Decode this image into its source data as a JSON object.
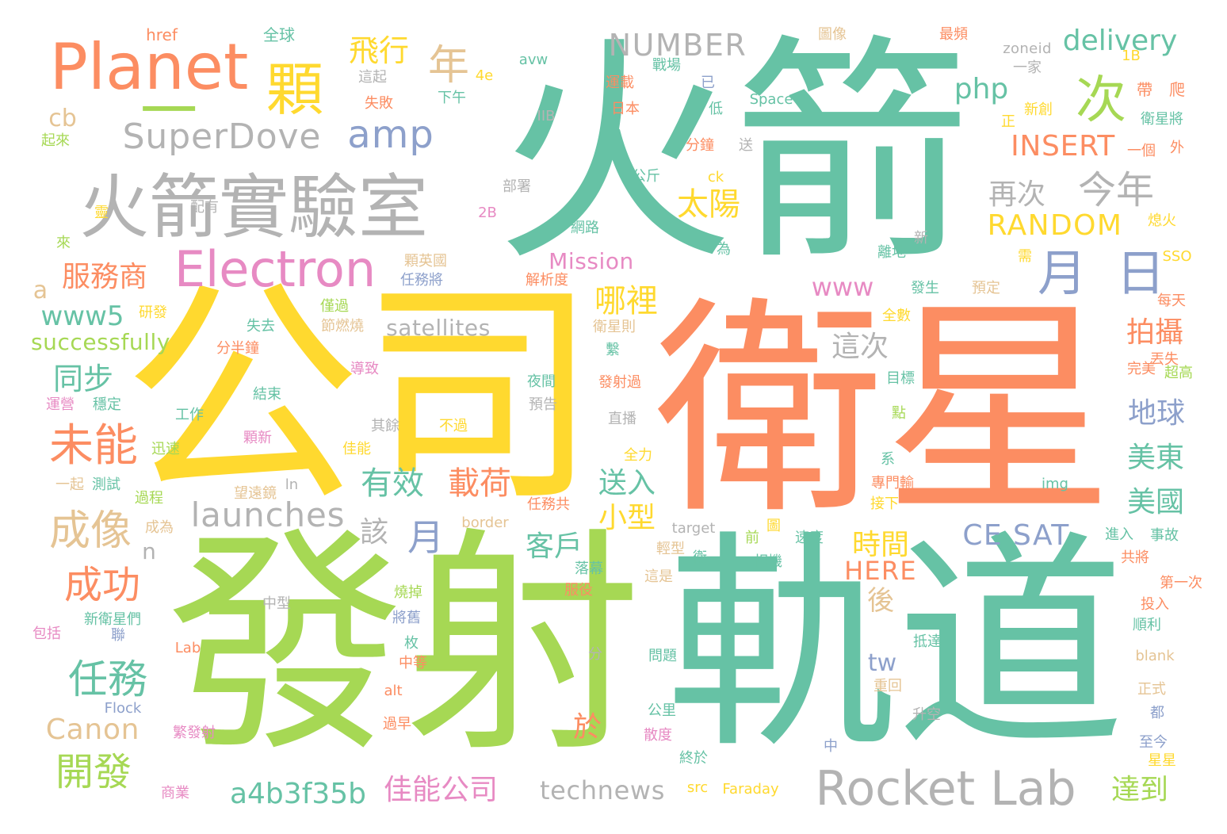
{
  "palette": {
    "teal": "#66c2a5",
    "orange": "#fc8d62",
    "blue": "#8da0cb",
    "pink": "#e78ac3",
    "green": "#a6d854",
    "yellow": "#ffd92f",
    "tan": "#e5c494",
    "gray": "#b3b3b3"
  },
  "words": [
    {
      "text": "火箭",
      "color": "teal"
    },
    {
      "text": "衛星",
      "color": "orange"
    },
    {
      "text": "公司",
      "color": "yellow"
    },
    {
      "text": "發射",
      "color": "green"
    },
    {
      "text": "軌道",
      "color": "teal"
    },
    {
      "text": "火箭實驗室",
      "color": "gray"
    },
    {
      "text": "Planet",
      "color": "orange"
    },
    {
      "text": "一",
      "color": "green"
    },
    {
      "text": "顆",
      "color": "yellow"
    },
    {
      "text": "Electron",
      "color": "pink"
    },
    {
      "text": "次",
      "color": "green"
    },
    {
      "text": "月",
      "color": "blue"
    },
    {
      "text": "日",
      "color": "blue"
    },
    {
      "text": "Rocket Lab",
      "color": "gray"
    },
    {
      "text": "SuperDove",
      "color": "gray"
    },
    {
      "text": "amp",
      "color": "blue"
    },
    {
      "text": "年",
      "color": "tan"
    },
    {
      "text": "飛行",
      "color": "yellow"
    },
    {
      "text": "NUMBER",
      "color": "gray"
    },
    {
      "text": "delivery",
      "color": "teal"
    },
    {
      "text": "php",
      "color": "teal"
    },
    {
      "text": "今年",
      "color": "gray"
    },
    {
      "text": "再次",
      "color": "gray"
    },
    {
      "text": "INSERT",
      "color": "orange"
    },
    {
      "text": "RANDOM",
      "color": "yellow"
    },
    {
      "text": "太陽",
      "color": "yellow"
    },
    {
      "text": "www",
      "color": "pink"
    },
    {
      "text": "Mission",
      "color": "pink"
    },
    {
      "text": "服務商",
      "color": "orange"
    },
    {
      "text": "cb",
      "color": "tan"
    },
    {
      "text": "a",
      "color": "tan"
    },
    {
      "text": "www5",
      "color": "teal"
    },
    {
      "text": "successfully",
      "color": "green"
    },
    {
      "text": "satellites",
      "color": "gray"
    },
    {
      "text": "哪裡",
      "color": "yellow"
    },
    {
      "text": "拍攝",
      "color": "orange"
    },
    {
      "text": "這次",
      "color": "gray"
    },
    {
      "text": "地球",
      "color": "blue"
    },
    {
      "text": "美東",
      "color": "teal"
    },
    {
      "text": "美國",
      "color": "teal"
    },
    {
      "text": "同步",
      "color": "teal"
    },
    {
      "text": "未能",
      "color": "orange"
    },
    {
      "text": "有效",
      "color": "teal"
    },
    {
      "text": "載荷",
      "color": "orange"
    },
    {
      "text": "送入",
      "color": "teal"
    },
    {
      "text": "小型",
      "color": "yellow"
    },
    {
      "text": "launches",
      "color": "gray"
    },
    {
      "text": "成像",
      "color": "tan"
    },
    {
      "text": "該",
      "color": "gray"
    },
    {
      "text": "月",
      "color": "blue"
    },
    {
      "text": "客戶",
      "color": "teal"
    },
    {
      "text": "CE SAT",
      "color": "blue"
    },
    {
      "text": "時間",
      "color": "yellow"
    },
    {
      "text": "HERE",
      "color": "orange"
    },
    {
      "text": "成功",
      "color": "orange"
    },
    {
      "text": "n",
      "color": "gray"
    },
    {
      "text": "後",
      "color": "tan"
    },
    {
      "text": "任務",
      "color": "teal"
    },
    {
      "text": "tw",
      "color": "blue"
    },
    {
      "text": "於",
      "color": "orange"
    },
    {
      "text": "Canon",
      "color": "tan"
    },
    {
      "text": "開發",
      "color": "green"
    },
    {
      "text": "a4b3f35b",
      "color": "teal"
    },
    {
      "text": "佳能公司",
      "color": "pink"
    },
    {
      "text": "technews",
      "color": "gray"
    },
    {
      "text": "達到",
      "color": "green"
    },
    {
      "text": "href",
      "color": "orange"
    },
    {
      "text": "全球",
      "color": "teal"
    },
    {
      "text": "4e",
      "color": "yellow"
    },
    {
      "text": "avw",
      "color": "teal"
    },
    {
      "text": "這起",
      "color": "gray"
    },
    {
      "text": "失敗",
      "color": "orange"
    },
    {
      "text": "下午",
      "color": "teal"
    },
    {
      "text": "起來",
      "color": "green"
    },
    {
      "text": "IIB",
      "color": "gray"
    },
    {
      "text": "戰場",
      "color": "teal"
    },
    {
      "text": "運載",
      "color": "orange"
    },
    {
      "text": "已",
      "color": "blue"
    },
    {
      "text": "低",
      "color": "teal"
    },
    {
      "text": "日本",
      "color": "orange"
    },
    {
      "text": "Space",
      "color": "teal"
    },
    {
      "text": "圖像",
      "color": "tan"
    },
    {
      "text": "最頻",
      "color": "orange"
    },
    {
      "text": "zoneid",
      "color": "gray"
    },
    {
      "text": "一家",
      "color": "gray"
    },
    {
      "text": "1B",
      "color": "yellow"
    },
    {
      "text": "帶",
      "color": "orange"
    },
    {
      "text": "爬",
      "color": "orange"
    },
    {
      "text": "新創",
      "color": "yellow"
    },
    {
      "text": "正",
      "color": "yellow"
    },
    {
      "text": "衛星將",
      "color": "teal"
    },
    {
      "text": "一個",
      "color": "orange"
    },
    {
      "text": "外",
      "color": "orange"
    },
    {
      "text": "分鐘",
      "color": "orange"
    },
    {
      "text": "送",
      "color": "gray"
    },
    {
      "text": "ck",
      "color": "yellow"
    },
    {
      "text": "公斤",
      "color": "teal"
    },
    {
      "text": "部署",
      "color": "gray"
    },
    {
      "text": "配有",
      "color": "gray"
    },
    {
      "text": "靈",
      "color": "yellow"
    },
    {
      "text": "來",
      "color": "green"
    },
    {
      "text": "2B",
      "color": "pink"
    },
    {
      "text": "網路",
      "color": "teal"
    },
    {
      "text": "為",
      "color": "teal"
    },
    {
      "text": "新",
      "color": "gray"
    },
    {
      "text": "熄火",
      "color": "yellow"
    },
    {
      "text": "需",
      "color": "yellow"
    },
    {
      "text": "SSO",
      "color": "yellow"
    },
    {
      "text": "顆英國",
      "color": "tan"
    },
    {
      "text": "任務將",
      "color": "blue"
    },
    {
      "text": "解析度",
      "color": "orange"
    },
    {
      "text": "離地",
      "color": "teal"
    },
    {
      "text": "發生",
      "color": "teal"
    },
    {
      "text": "預定",
      "color": "tan"
    },
    {
      "text": "每天",
      "color": "orange"
    },
    {
      "text": "研發",
      "color": "yellow"
    },
    {
      "text": "僅過",
      "color": "green"
    },
    {
      "text": "節燃燒",
      "color": "tan"
    },
    {
      "text": "失去",
      "color": "teal"
    },
    {
      "text": "衛星則",
      "color": "tan"
    },
    {
      "text": "全數",
      "color": "yellow"
    },
    {
      "text": "丟失",
      "color": "orange"
    },
    {
      "text": "超高",
      "color": "green"
    },
    {
      "text": "完美",
      "color": "orange"
    },
    {
      "text": "分半鐘",
      "color": "orange"
    },
    {
      "text": "繫",
      "color": "teal"
    },
    {
      "text": "導致",
      "color": "pink"
    },
    {
      "text": "結束",
      "color": "teal"
    },
    {
      "text": "夜間",
      "color": "teal"
    },
    {
      "text": "發射過",
      "color": "orange"
    },
    {
      "text": "目標",
      "color": "teal"
    },
    {
      "text": "運營",
      "color": "pink"
    },
    {
      "text": "穩定",
      "color": "teal"
    },
    {
      "text": "工作",
      "color": "teal"
    },
    {
      "text": "預告",
      "color": "gray"
    },
    {
      "text": "點",
      "color": "green"
    },
    {
      "text": "其餘",
      "color": "gray"
    },
    {
      "text": "不過",
      "color": "yellow"
    },
    {
      "text": "直播",
      "color": "gray"
    },
    {
      "text": "迅速",
      "color": "green"
    },
    {
      "text": "顆新",
      "color": "pink"
    },
    {
      "text": "佳能",
      "color": "yellow"
    },
    {
      "text": "全力",
      "color": "yellow"
    },
    {
      "text": "系",
      "color": "teal"
    },
    {
      "text": "一起",
      "color": "tan"
    },
    {
      "text": "測試",
      "color": "teal"
    },
    {
      "text": "ln",
      "color": "gray"
    },
    {
      "text": "專門輸",
      "color": "orange"
    },
    {
      "text": "img",
      "color": "teal"
    },
    {
      "text": "過程",
      "color": "green"
    },
    {
      "text": "望遠鏡",
      "color": "tan"
    },
    {
      "text": "任務共",
      "color": "orange"
    },
    {
      "text": "接下",
      "color": "yellow"
    },
    {
      "text": "成為",
      "color": "tan"
    },
    {
      "text": "border",
      "color": "tan"
    },
    {
      "text": "target",
      "color": "gray"
    },
    {
      "text": "圖",
      "color": "yellow"
    },
    {
      "text": "進入",
      "color": "teal"
    },
    {
      "text": "事故",
      "color": "teal"
    },
    {
      "text": "輕型",
      "color": "tan"
    },
    {
      "text": "前",
      "color": "green"
    },
    {
      "text": "速度",
      "color": "teal"
    },
    {
      "text": "共將",
      "color": "orange"
    },
    {
      "text": "衛",
      "color": "teal"
    },
    {
      "text": "落幕",
      "color": "teal"
    },
    {
      "text": "相機",
      "color": "teal"
    },
    {
      "text": "這是",
      "color": "tan"
    },
    {
      "text": "第一次",
      "color": "orange"
    },
    {
      "text": "服役",
      "color": "orange"
    },
    {
      "text": "中型",
      "color": "gray"
    },
    {
      "text": "燒掉",
      "color": "green"
    },
    {
      "text": "投入",
      "color": "orange"
    },
    {
      "text": "新衛星們",
      "color": "teal"
    },
    {
      "text": "將舊",
      "color": "blue"
    },
    {
      "text": "順利",
      "color": "teal"
    },
    {
      "text": "包括",
      "color": "pink"
    },
    {
      "text": "聯",
      "color": "blue"
    },
    {
      "text": "枚",
      "color": "teal"
    },
    {
      "text": "抵達",
      "color": "teal"
    },
    {
      "text": "Lab",
      "color": "orange"
    },
    {
      "text": "分",
      "color": "gray"
    },
    {
      "text": "問題",
      "color": "teal"
    },
    {
      "text": "blank",
      "color": "tan"
    },
    {
      "text": "中等",
      "color": "orange"
    },
    {
      "text": "重回",
      "color": "tan"
    },
    {
      "text": "alt",
      "color": "orange"
    },
    {
      "text": "正式",
      "color": "tan"
    },
    {
      "text": "Flock",
      "color": "blue"
    },
    {
      "text": "公里",
      "color": "teal"
    },
    {
      "text": "升空",
      "color": "gray"
    },
    {
      "text": "都",
      "color": "blue"
    },
    {
      "text": "過早",
      "color": "orange"
    },
    {
      "text": "繁發射",
      "color": "pink"
    },
    {
      "text": "散度",
      "color": "pink"
    },
    {
      "text": "至今",
      "color": "blue"
    },
    {
      "text": "中",
      "color": "blue"
    },
    {
      "text": "星星",
      "color": "yellow"
    },
    {
      "text": "終於",
      "color": "teal"
    },
    {
      "text": "src",
      "color": "yellow"
    },
    {
      "text": "Faraday",
      "color": "yellow"
    },
    {
      "text": "商業",
      "color": "pink"
    }
  ]
}
